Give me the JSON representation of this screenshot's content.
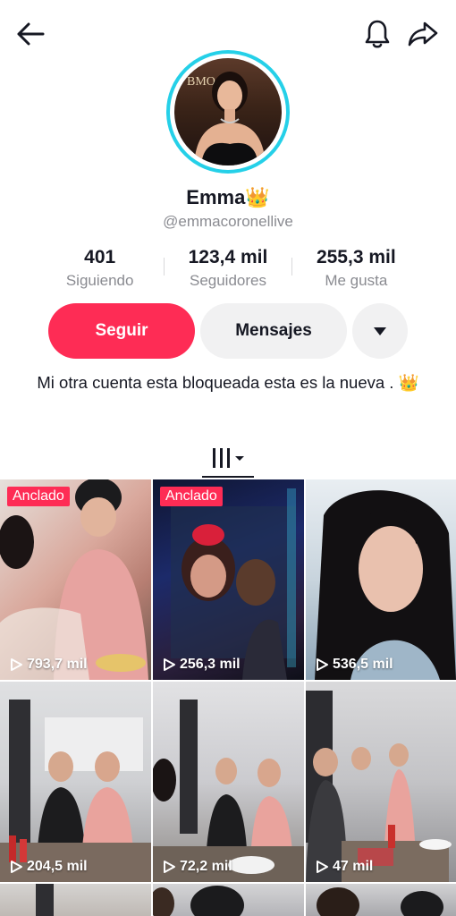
{
  "profile": {
    "name": "Emma",
    "name_emoji": "👑",
    "handle": "@emmacoronellive",
    "avatar_text": "BMO",
    "bio": "Mi  otra cuenta esta  bloqueada esta  es la nueva . 👑"
  },
  "stats": [
    {
      "value": "401",
      "label": "Siguiendo"
    },
    {
      "value": "123,4 mil",
      "label": "Seguidores"
    },
    {
      "value": "255,3 mil",
      "label": "Me gusta"
    }
  ],
  "actions": {
    "follow_label": "Seguir",
    "message_label": "Mensajes"
  },
  "videos": [
    {
      "pinned": "Anclado",
      "views": "793,7 mil"
    },
    {
      "pinned": "Anclado",
      "views": "256,3 mil"
    },
    {
      "views": "536,5 mil"
    },
    {
      "views": "204,5 mil"
    },
    {
      "views": "72,2 mil"
    },
    {
      "views": "47 mil"
    }
  ],
  "colors": {
    "accent": "#fe2c55",
    "avatar_ring": "#25d0e8",
    "secondary_button": "#f1f1f2",
    "muted_text": "#8a8b91"
  },
  "icons": {
    "back": "arrow-left-icon",
    "notifications": "bell-icon",
    "share": "share-arrow-icon",
    "more": "caret-down-icon",
    "grid": "video-grid-icon",
    "play": "play-icon"
  }
}
